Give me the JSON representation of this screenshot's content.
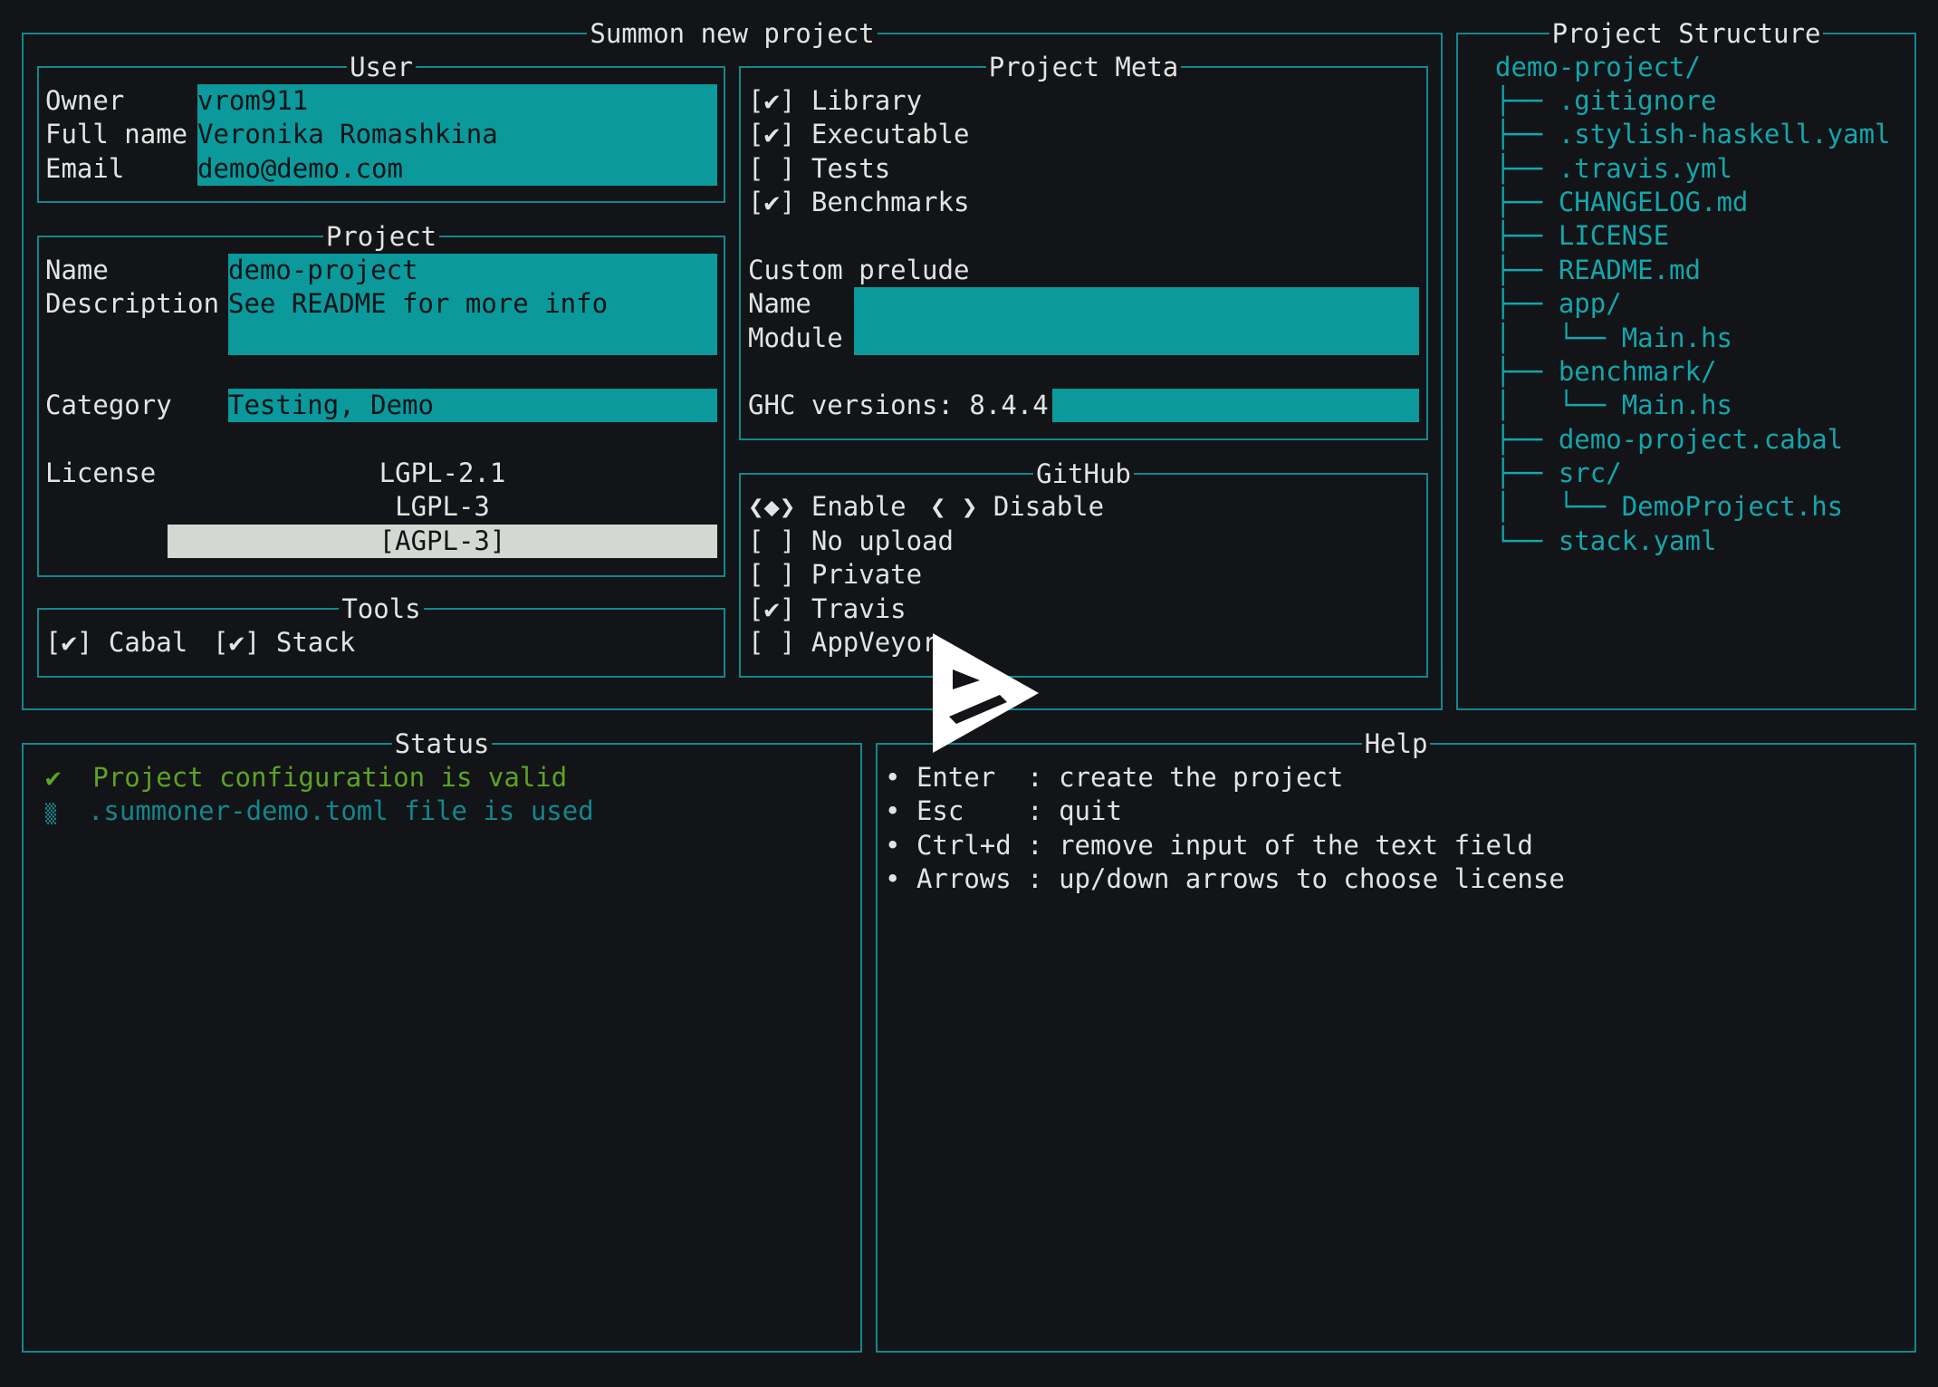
{
  "app": {
    "title": "Summon new project"
  },
  "user": {
    "title": "User",
    "fields": [
      {
        "label": "Owner",
        "value": "vrom911"
      },
      {
        "label": "Full name",
        "value": "Veronika Romashkina"
      },
      {
        "label": "Email",
        "value": "demo@demo.com"
      }
    ]
  },
  "project": {
    "title": "Project",
    "name_label": "Name",
    "name_value": "demo-project",
    "description_label": "Description",
    "description_value": "See README for more info",
    "category_label": "Category",
    "category_value": "Testing, Demo",
    "license_label": "License",
    "licenses": [
      "LGPL-2.1",
      "LGPL-3",
      "[AGPL-3]"
    ]
  },
  "tools": {
    "title": "Tools",
    "items": [
      {
        "mark": "[✔]",
        "label": "Cabal"
      },
      {
        "mark": "[✔]",
        "label": "Stack"
      }
    ]
  },
  "meta": {
    "title": "Project Meta",
    "checks": [
      {
        "mark": "[✔]",
        "label": "Library"
      },
      {
        "mark": "[✔]",
        "label": "Executable"
      },
      {
        "mark": "[ ]",
        "label": "Tests"
      },
      {
        "mark": "[✔]",
        "label": "Benchmarks"
      }
    ],
    "prelude_label": "Custom prelude",
    "prelude_name_label": "Name",
    "prelude_module_label": "Module",
    "ghc_label": "GHC versions: 8.4.4"
  },
  "github": {
    "title": "GitHub",
    "enable": {
      "mark": "❮◆❯",
      "label": "Enable"
    },
    "disable": {
      "mark": "❮ ❯",
      "label": "Disable"
    },
    "checks": [
      {
        "mark": "[ ]",
        "label": "No upload"
      },
      {
        "mark": "[ ]",
        "label": "Private"
      },
      {
        "mark": "[✔]",
        "label": "Travis"
      },
      {
        "mark": "[ ]",
        "label": "AppVeyor"
      }
    ]
  },
  "structure": {
    "title": "Project Structure",
    "lines": [
      {
        "prefix": "",
        "name": "demo-project/"
      },
      {
        "prefix": "├── ",
        "name": ".gitignore"
      },
      {
        "prefix": "├── ",
        "name": ".stylish-haskell.yaml"
      },
      {
        "prefix": "├── ",
        "name": ".travis.yml"
      },
      {
        "prefix": "├── ",
        "name": "CHANGELOG.md"
      },
      {
        "prefix": "├── ",
        "name": "LICENSE"
      },
      {
        "prefix": "├── ",
        "name": "README.md"
      },
      {
        "prefix": "├── ",
        "name": "app/"
      },
      {
        "prefix": "│   └── ",
        "name": "Main.hs"
      },
      {
        "prefix": "├── ",
        "name": "benchmark/"
      },
      {
        "prefix": "│   └── ",
        "name": "Main.hs"
      },
      {
        "prefix": "├── ",
        "name": "demo-project.cabal"
      },
      {
        "prefix": "├── ",
        "name": "src/"
      },
      {
        "prefix": "│   └── ",
        "name": "DemoProject.hs"
      },
      {
        "prefix": "└── ",
        "name": "stack.yaml"
      }
    ]
  },
  "status": {
    "title": "Status",
    "items": [
      {
        "icon": "✔",
        "text": "Project configuration is valid"
      },
      {
        "icon": "▒",
        "text": ".summoner-demo.toml file is used"
      }
    ]
  },
  "help": {
    "title": "Help",
    "items": [
      {
        "bullet": "•",
        "key": "Enter ",
        "sep": " : ",
        "desc": "create the project"
      },
      {
        "bullet": "•",
        "key": "Esc   ",
        "sep": " : ",
        "desc": "quit"
      },
      {
        "bullet": "•",
        "key": "Ctrl+d",
        "sep": " : ",
        "desc": "remove input of the text field"
      },
      {
        "bullet": "•",
        "key": "Arrows",
        "sep": " : ",
        "desc": "up/down arrows to choose license"
      }
    ]
  },
  "colors": {
    "background": "#121417",
    "border": "#12888c",
    "field": "#0b999c",
    "tree": "#13a6ac",
    "valid": "#5ca325",
    "file_note": "#14868c",
    "selected_license": "#d5d7d2"
  },
  "icons": {
    "play_overlay": "play-logo-icon"
  }
}
